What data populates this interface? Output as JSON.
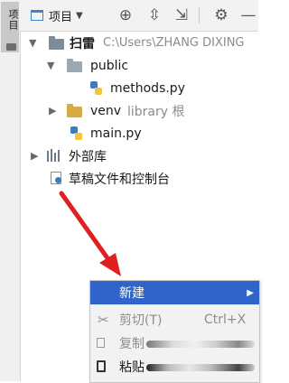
{
  "strip": {
    "tab_label": "项目"
  },
  "toolbar": {
    "view_label": "项目",
    "view_caret": "▼",
    "locate_glyph": "⊕",
    "expand_glyph": "⇳",
    "collapse_glyph": "⇲",
    "gear_glyph": "⚙",
    "hide_glyph": "—"
  },
  "tree": {
    "root": {
      "name": "扫雷",
      "path": "C:\\Users\\ZHANG DIXING"
    },
    "public": {
      "name": "public"
    },
    "methods": {
      "name": "methods.py"
    },
    "venv": {
      "name": "venv",
      "hint": "library 根"
    },
    "main": {
      "name": "main.py"
    },
    "external": {
      "name": "外部库"
    },
    "scratch": {
      "name": "草稿文件和控制台"
    }
  },
  "context_menu": {
    "new": {
      "label": "新建",
      "arrow": "▶"
    },
    "cut": {
      "label": "剪切(T)",
      "shortcut": "Ctrl+X",
      "icon": "✂"
    },
    "copy": {
      "label": "复制"
    },
    "paste": {
      "label": "粘贴",
      "icon": "📋"
    }
  },
  "colors": {
    "selection": "#2f65ca",
    "annotation_arrow": "#e02020",
    "venv_folder": "#d9a945"
  }
}
